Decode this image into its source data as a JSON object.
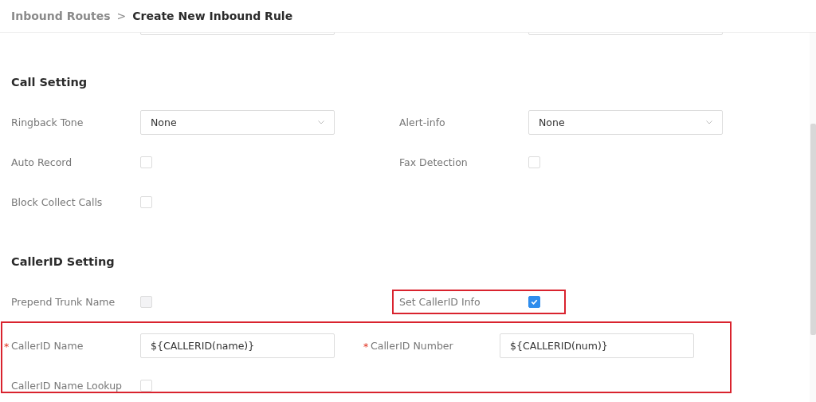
{
  "breadcrumb": [
    {
      "label": "Inbound Routes",
      "selected": false
    },
    {
      "label": "Create New Inbound Rule",
      "selected": true
    }
  ],
  "breadcrumb_separator": ">",
  "partial_row": {
    "cells": [
      {
        "kind": "text"
      },
      {
        "kind": "text"
      }
    ]
  },
  "sections": [
    {
      "title": "Call Setting",
      "blocks": [
        {
          "highlighted": false,
          "rows": [
            {
              "cells": [
                {
                  "label": "Ringback Tone",
                  "kind": "select",
                  "value": "None"
                },
                {
                  "label": "Alert-info",
                  "kind": "select",
                  "value": "None"
                }
              ]
            },
            {
              "cells": [
                {
                  "label": "Auto Record",
                  "kind": "checkbox",
                  "checked": false,
                  "disabled": false
                },
                {
                  "label": "Fax Detection",
                  "kind": "checkbox",
                  "checked": false,
                  "disabled": false
                }
              ]
            },
            {
              "cells": [
                {
                  "label": "Block Collect Calls",
                  "kind": "checkbox",
                  "checked": false,
                  "disabled": false
                }
              ]
            }
          ]
        }
      ]
    },
    {
      "title": "CallerID Setting",
      "blocks": [
        {
          "highlighted": false,
          "rows": [
            {
              "cells": [
                {
                  "label": "Prepend Trunk Name",
                  "kind": "checkbox",
                  "checked": false,
                  "disabled": true
                },
                {
                  "label": "Set CallerID Info",
                  "kind": "checkbox",
                  "checked": true,
                  "disabled": false,
                  "highlighted": true
                }
              ]
            }
          ]
        },
        {
          "highlighted": true,
          "rows": [
            {
              "cells": [
                {
                  "label": "CallerID Name",
                  "marker": "*",
                  "kind": "text",
                  "value": "${CALLERID(name)}"
                },
                {
                  "label": "CallerID Number",
                  "marker": "*",
                  "kind": "text",
                  "value": "${CALLERID(num)}"
                }
              ]
            },
            {
              "cells": [
                {
                  "label": "CallerID Name Lookup",
                  "kind": "checkbox",
                  "checked": false,
                  "disabled": false
                }
              ]
            }
          ]
        }
      ]
    }
  ]
}
